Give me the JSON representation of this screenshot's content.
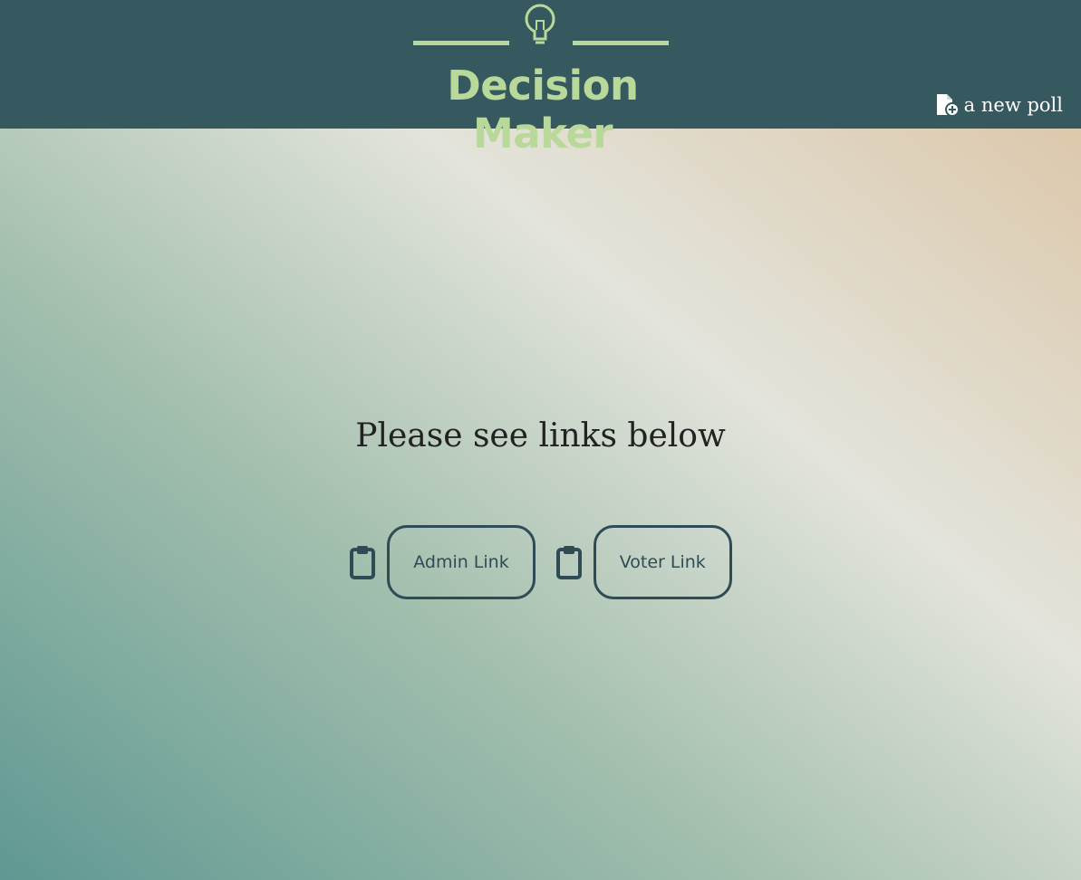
{
  "header": {
    "logo_title": "Decision Maker",
    "logo_icon": "lightbulb-icon",
    "new_poll_icon": "file-plus-icon",
    "new_poll_label": "a new poll"
  },
  "main": {
    "heading": "Please see links below",
    "links": [
      {
        "copy_icon": "clipboard-icon",
        "label": "Admin Link"
      },
      {
        "copy_icon": "clipboard-icon",
        "label": "Voter Link"
      }
    ]
  },
  "colors": {
    "header_bg": "#36585f",
    "logo_green": "#b9d99b",
    "button_border": "#2f4b55",
    "heading_text": "#222222"
  }
}
